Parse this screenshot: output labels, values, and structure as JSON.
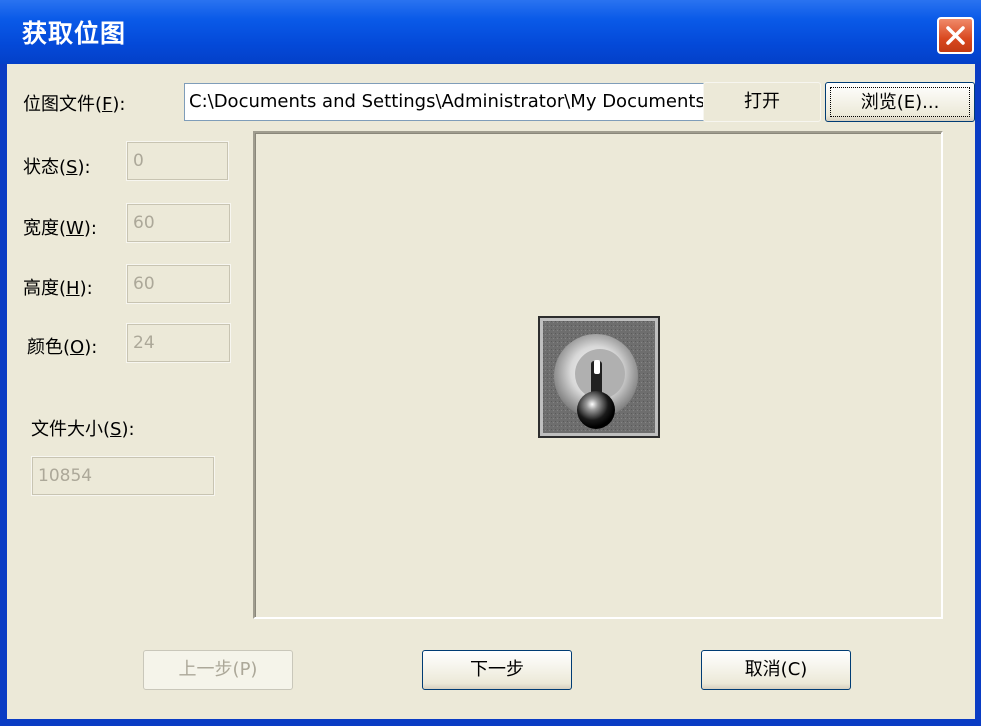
{
  "window": {
    "title": "获取位图"
  },
  "bitmap_file": {
    "label": "位图文件(",
    "accel": "F",
    "label_end": "):",
    "path": "C:\\Documents and Settings\\Administrator\\My Documents",
    "open_label": "打开",
    "browse_label": "浏览(E)..."
  },
  "fields": {
    "state": {
      "label": "状态(",
      "accel": "S",
      "label_end": "):",
      "value": "0"
    },
    "width": {
      "label": "宽度(",
      "accel": "W",
      "label_end": "):",
      "value": "60"
    },
    "height": {
      "label": "高度(",
      "accel": "H",
      "label_end": "):",
      "value": "60"
    },
    "color": {
      "label": "颜色(",
      "accel": "O",
      "label_end": "):",
      "value": "24"
    },
    "file_size": {
      "label": "文件大小(",
      "accel": "S",
      "label_end": "):",
      "value": "10854"
    }
  },
  "preview": {
    "icon": "joystick-icon"
  },
  "footer": {
    "back_label": "上一步(P)",
    "next_label": "下一步",
    "cancel_label": "取消(C)"
  }
}
